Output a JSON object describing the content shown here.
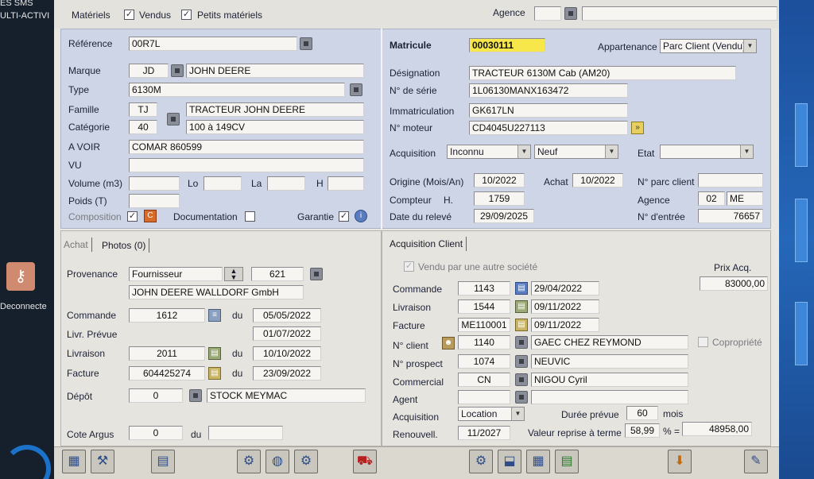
{
  "desktop": {
    "left_text_1": "ES SMS",
    "left_text_2": "ULTI-ACTIVI",
    "left_text_3": "Deconnecte"
  },
  "topbar": {
    "materiels": "Matériels",
    "vendus": "Vendus",
    "petits_materiels": "Petits matériels",
    "agence_label": "Agence"
  },
  "materiel": {
    "reference_label": "Référence",
    "reference": "00R7L",
    "marque_label": "Marque",
    "marque_code": "JD",
    "marque_name": "JOHN DEERE",
    "type_label": "Type",
    "type": "6130M",
    "famille_label": "Famille",
    "famille_code": "TJ",
    "famille_name": "TRACTEUR JOHN DEERE",
    "categorie_label": "Catégorie",
    "categorie_code": "40",
    "categorie_name": "100 à 149CV",
    "avoir_label": "A VOIR",
    "avoir": "COMAR 860599",
    "vu_label": "VU",
    "volume_label": "Volume (m3)",
    "lo_label": "Lo",
    "la_label": "La",
    "h_label": "H",
    "poids_label": "Poids (T)",
    "composition_label": "Composition",
    "documentation_label": "Documentation",
    "garantie_label": "Garantie"
  },
  "identification": {
    "matricule_label": "Matricule",
    "matricule": "00030111",
    "appartenance_label": "Appartenance",
    "appartenance": "Parc Client (Vendu)",
    "designation_label": "Désignation",
    "designation": "TRACTEUR 6130M Cab (AM20)",
    "serie_label": "N° de série",
    "serie": "1L06130MANX163472",
    "immat_label": "Immatriculation",
    "immat": "GK617LN",
    "moteur_label": "N° moteur",
    "moteur": "CD4045U227113",
    "acquisition_label": "Acquisition",
    "acquisition": "Inconnu",
    "etat_neuf": "Neuf",
    "etat_label": "Etat",
    "origine_label": "Origine (Mois/An)",
    "origine": "10/2022",
    "achat_label": "Achat",
    "achat": "10/2022",
    "parc_client_label": "N° parc client",
    "compteur_label": "Compteur",
    "compteur_unit": "H.",
    "compteur": "1759",
    "agence_label": "Agence",
    "agence_code": "02",
    "agence_name": "ME",
    "releve_label": "Date du relevé",
    "releve": "29/09/2025",
    "entree_label": "N° d'entrée",
    "entree": "76657"
  },
  "tabs_left": [
    "Achat",
    "Photos (0)"
  ],
  "achat": {
    "provenance_label": "Provenance",
    "provenance": "Fournisseur",
    "provenance_code": "621",
    "fournisseur": "JOHN DEERE WALLDORF GmbH",
    "commande_label": "Commande",
    "commande": "1612",
    "du": "du",
    "commande_date": "05/05/2022",
    "livr_prevue_label": "Livr. Prévue",
    "livr_prevue": "01/07/2022",
    "livraison_label": "Livraison",
    "livraison": "2011",
    "livraison_date": "10/10/2022",
    "facture_label": "Facture",
    "facture": "604425274",
    "facture_date": "23/09/2022",
    "depot_label": "Dépôt",
    "depot": "0",
    "depot_name": "STOCK MEYMAC",
    "cote_label": "Cote Argus",
    "cote": "0",
    "cote_du": "du"
  },
  "tab_right": "Acquisition Client",
  "client": {
    "vendu_autre": "Vendu par une autre société",
    "prix_label": "Prix Acq.",
    "prix": "83000,00",
    "commande_label": "Commande",
    "commande": "1143",
    "commande_date": "29/04/2022",
    "livraison_label": "Livraison",
    "livraison": "1544",
    "livraison_date": "09/11/2022",
    "facture_label": "Facture",
    "facture": "ME110001",
    "facture_date": "09/11/2022",
    "client_label": "N° client",
    "client_code": "1140",
    "client_name": "GAEC CHEZ REYMOND",
    "copropriete": "Copropriété",
    "prospect_label": "N° prospect",
    "prospect": "1074",
    "prospect_name": "NEUVIC",
    "commercial_label": "Commercial",
    "commercial_code": "CN",
    "commercial_name": "NIGOU Cyril",
    "agent_label": "Agent",
    "acquisition_label": "Acquisition",
    "acquisition": "Location",
    "duree_label": "Durée prévue",
    "duree": "60",
    "duree_unit": "mois",
    "renouvell_label": "Renouvell.",
    "renouvell": "11/2027",
    "valeur_label": "Valeur reprise à terme",
    "valeur_pct": "58,99",
    "pct_eq": "% =",
    "valeur": "48958,00"
  },
  "toolbar_icons": [
    "grid-icon",
    "tools-icon",
    "document-icon",
    "search-tools-icon",
    "globe-tools-icon",
    "settings-tools-icon",
    "tractor-icon",
    "gear-icon",
    "stamp-icon",
    "calendar-icon",
    "report-icon",
    "download-icon",
    "pen-icon"
  ]
}
